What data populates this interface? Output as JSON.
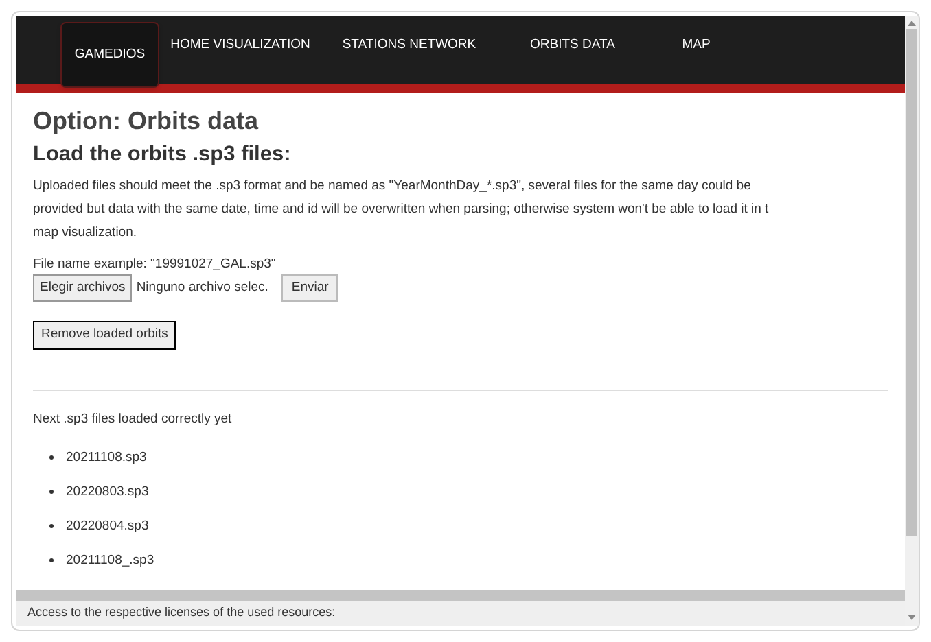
{
  "nav": [
    {
      "label": "GAMEDIOS",
      "selected": true
    },
    {
      "label": "HOME VISUALIZATION",
      "selected": false
    },
    {
      "label": "STATIONS NETWORK",
      "selected": false
    },
    {
      "label": "ORBITS DATA",
      "selected": false
    },
    {
      "label": "MAP",
      "selected": false
    }
  ],
  "title": "Option: Orbits data",
  "subtitle": "Load the orbits .sp3 files:",
  "description_lines": [
    "Uploaded files should meet the .sp3 format and be named as \"YearMonthDay_*.sp3\", several files for the same day could be",
    "provided but data with the same date, time and id will be overwritten when parsing; otherwise system won't be able to load it in t",
    "map visualization."
  ],
  "example": "File name example: \"19991027_GAL.sp3\"",
  "file_input": {
    "button": "Elegir archivos",
    "status": "Ninguno archivo selec."
  },
  "submit_button": "Enviar",
  "remove_button": "Remove loaded orbits",
  "loaded_heading": "Next .sp3 files loaded correctly yet",
  "loaded_files": [
    "20211108.sp3",
    "20220803.sp3",
    "20220804.sp3",
    "20211108_.sp3"
  ],
  "footer": "Access to the respective licenses of the used resources:"
}
